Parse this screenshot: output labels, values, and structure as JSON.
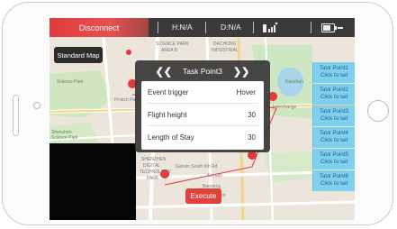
{
  "topbar": {
    "disconnect_label": "Disconnect",
    "h_label": "H:N/A",
    "d_label": "D:N/A",
    "signal_icon": "signal-icon",
    "battery_icon": "battery-icon",
    "accent_color": "#e03a3a"
  },
  "standard_map_label": "Standard Map",
  "dialog": {
    "title": "Task Point3",
    "prev": "❮❮",
    "next": "❯❯",
    "rows": [
      {
        "label": "Event trigger",
        "value": "Hover"
      },
      {
        "label": "Flight height",
        "value": "30"
      },
      {
        "label": "Length of Stay",
        "value": "30"
      }
    ]
  },
  "task_points": [
    {
      "name": "Task Point1",
      "action": "Click to set"
    },
    {
      "name": "Task Point2",
      "action": "Click to set"
    },
    {
      "name": "Task Point3",
      "action": "Click to set"
    },
    {
      "name": "Task Point4",
      "action": "Click to set"
    },
    {
      "name": "Task Point5",
      "action": "Click to set"
    },
    {
      "name": "Task Point6",
      "action": "Click to set"
    }
  ],
  "execute_label": "Execute",
  "map_labels": {
    "l1": "SCIENCE PARK",
    "l2": "AREA B",
    "l3": "DACHONG",
    "l4": "INDUSTRIAL",
    "l5": "Science Park",
    "l6": "Shenzhen",
    "l7": "Science Park",
    "l8": "Hi-tech Park",
    "l9": "Gaoxin South 6th Rd",
    "l10": "Keyuan",
    "l11": "Nanshan",
    "l12": "SHENZHEN",
    "l13": "DIGITAL",
    "l14": "TECHNOLOGY",
    "l15": "PARK",
    "l16": "Baoneng",
    "l17": "Interchange",
    "l18": "Tencent"
  }
}
